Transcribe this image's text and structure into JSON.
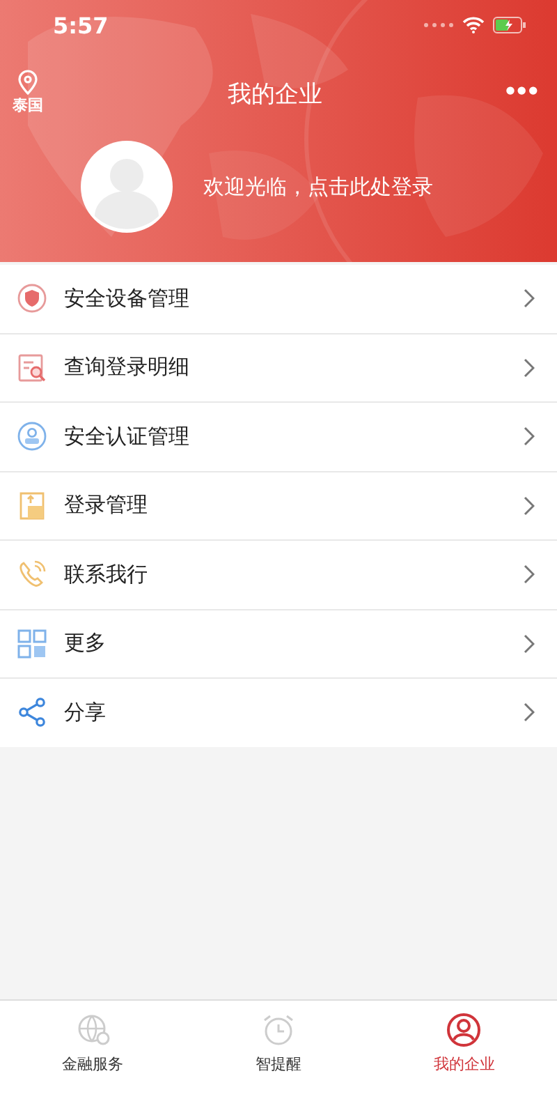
{
  "status_bar": {
    "time": "5:57"
  },
  "header": {
    "location": "泰国",
    "title": "我的企业",
    "more": "•••",
    "welcome": "欢迎光临，点击此处登录"
  },
  "menu": [
    {
      "kind": "shield",
      "label": "安全设备管理"
    },
    {
      "kind": "query",
      "label": "查询登录明细"
    },
    {
      "kind": "auth",
      "label": "安全认证管理"
    },
    {
      "kind": "login",
      "label": "登录管理"
    },
    {
      "kind": "phone",
      "label": "联系我行"
    },
    {
      "kind": "grid",
      "label": "更多"
    },
    {
      "kind": "share",
      "label": "分享"
    }
  ],
  "tab_bar": [
    {
      "kind": "globe",
      "label": "金融服务",
      "selected": false
    },
    {
      "kind": "clock",
      "label": "智提醒",
      "selected": false
    },
    {
      "kind": "user",
      "label": "我的企业",
      "selected": true
    }
  ]
}
